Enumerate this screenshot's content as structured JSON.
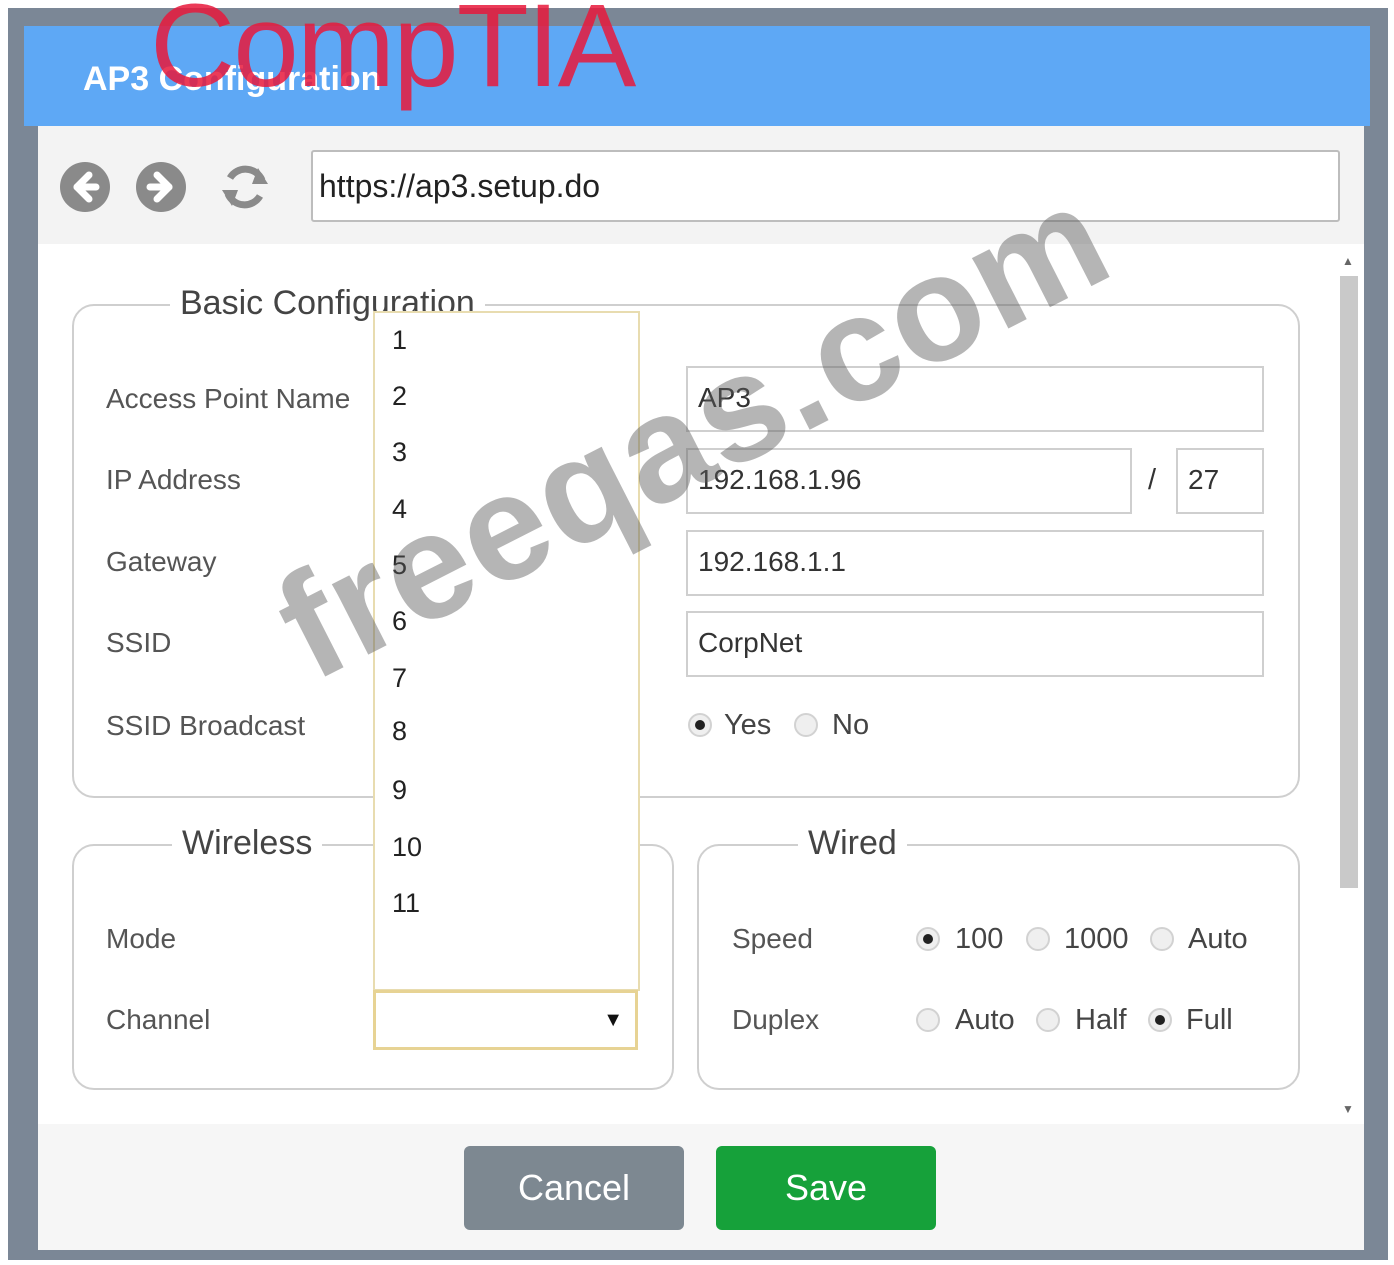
{
  "window": {
    "title": "AP3 Configuration",
    "brand_logo": "CompTIA"
  },
  "browser": {
    "url": "https://ap3.setup.do",
    "back_icon": "back-arrow-icon",
    "forward_icon": "forward-arrow-icon",
    "refresh_icon": "refresh-icon"
  },
  "basic": {
    "legend": "Basic Configuration",
    "ap_name_label": "Access Point Name",
    "ap_name_value": "AP3",
    "ip_label": "IP Address",
    "ip_value": "192.168.1.96",
    "ip_sep": "/",
    "prefix_value": "27",
    "gateway_label": "Gateway",
    "gateway_value": "192.168.1.1",
    "ssid_label": "SSID",
    "ssid_value": "CorpNet",
    "broadcast_label": "SSID Broadcast",
    "broadcast_yes": "Yes",
    "broadcast_no": "No",
    "broadcast_selected": "Yes"
  },
  "wireless": {
    "legend": "Wireless",
    "mode_label": "Mode",
    "channel_label": "Channel",
    "channel_value": "",
    "channel_options": [
      "1",
      "2",
      "3",
      "4",
      "5",
      "6",
      "7",
      "8",
      "9",
      "10",
      "11"
    ]
  },
  "wired": {
    "legend": "Wired",
    "speed_label": "Speed",
    "speed_opts": [
      "100",
      "1000",
      "Auto"
    ],
    "speed_selected": "100",
    "duplex_label": "Duplex",
    "duplex_opts": [
      "Auto",
      "Half",
      "Full"
    ],
    "duplex_selected": "Full"
  },
  "footer": {
    "cancel_label": "Cancel",
    "save_label": "Save"
  },
  "watermark": "freeqas.com",
  "colors": {
    "titlebar": "#5ea8f5",
    "save": "#16a13a",
    "cancel": "#7d8891",
    "logo": "#e8193c"
  }
}
